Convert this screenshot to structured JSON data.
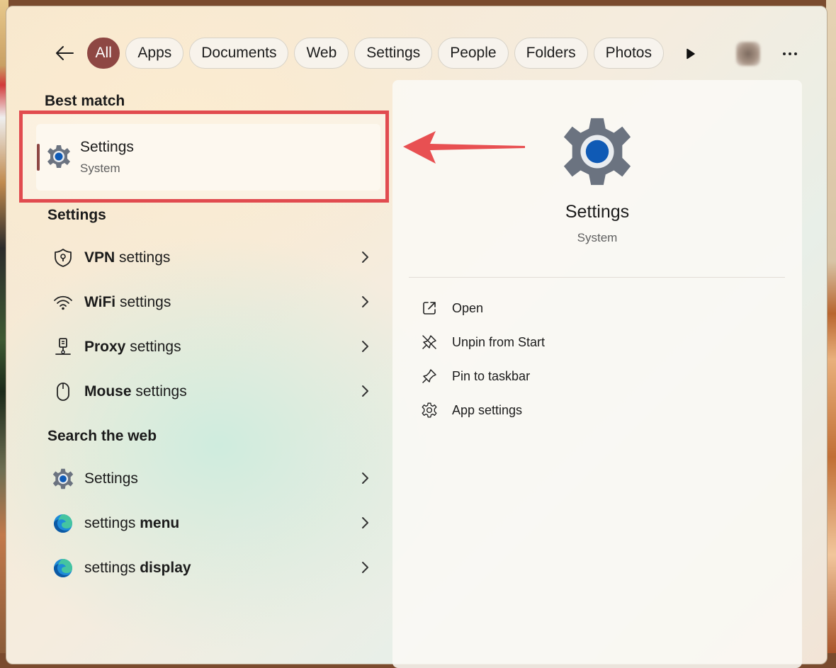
{
  "filters": {
    "back_icon": "arrow-left-icon",
    "pills": [
      {
        "label": "All",
        "active": true
      },
      {
        "label": "Apps",
        "active": false
      },
      {
        "label": "Documents",
        "active": false
      },
      {
        "label": "Web",
        "active": false
      },
      {
        "label": "Settings",
        "active": false
      },
      {
        "label": "People",
        "active": false
      },
      {
        "label": "Folders",
        "active": false
      },
      {
        "label": "Photos",
        "active": false
      }
    ],
    "play_icon": "play-icon",
    "more_icon": "more-horizontal-icon"
  },
  "best_match": {
    "heading": "Best match",
    "title": "Settings",
    "subtitle": "System",
    "icon": "settings-gear-icon"
  },
  "settings_section": {
    "heading": "Settings",
    "items": [
      {
        "bold": "VPN",
        "rest": " settings",
        "icon": "vpn-shield-icon"
      },
      {
        "bold": "WiFi",
        "rest": " settings",
        "icon": "wifi-icon"
      },
      {
        "bold": "Proxy",
        "rest": " settings",
        "icon": "proxy-icon"
      },
      {
        "bold": "Mouse",
        "rest": " settings",
        "icon": "mouse-icon"
      }
    ]
  },
  "web_section": {
    "heading": "Search the web",
    "items": [
      {
        "pre": "Settings",
        "bold": "",
        "icon": "settings-gear-icon"
      },
      {
        "pre": "settings ",
        "bold": "menu",
        "icon": "edge-icon"
      },
      {
        "pre": "settings ",
        "bold": "display",
        "icon": "edge-icon"
      }
    ]
  },
  "preview": {
    "title": "Settings",
    "subtitle": "System",
    "actions": [
      {
        "label": "Open",
        "icon": "open-external-icon"
      },
      {
        "label": "Unpin from Start",
        "icon": "unpin-icon"
      },
      {
        "label": "Pin to taskbar",
        "icon": "pin-icon"
      },
      {
        "label": "App settings",
        "icon": "gear-outline-icon"
      }
    ]
  },
  "colors": {
    "accent": "#8e4743",
    "highlight": "#e14b4f",
    "gear_blue": "#0f5ab5"
  }
}
